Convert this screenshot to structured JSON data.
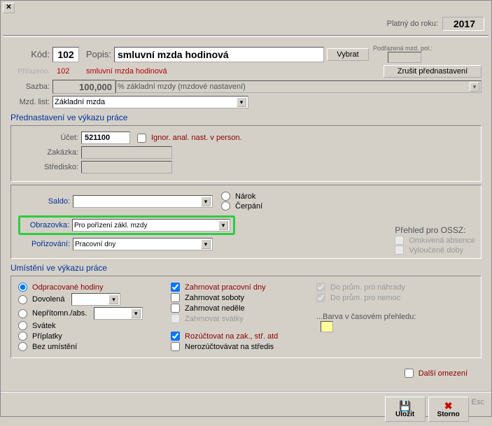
{
  "header": {
    "validToLabel": "Platný do roku:",
    "year": "2017"
  },
  "mainRow": {
    "kodLabel": "Kód:",
    "kod": "102",
    "popisLabel": "Popis:",
    "popis": "smluvní mzda hodinová",
    "vybratBtn": "Vybrat",
    "podrazenaLabel": "Podřazená mzd. pol.:",
    "prirazeno": "Přiřazeno:",
    "prirazenoKod": "102",
    "prirazenoText": "smluvní mzda hodinová",
    "zrusitBtn": "Zrušit přednastavení"
  },
  "sazba": {
    "label": "Sazba:",
    "value": "100,000",
    "unit": "% základní mzdy (mzdové nastavení)"
  },
  "mzdList": {
    "label": "Mzd. list:",
    "value": "Základní mzda"
  },
  "prednastaveni": {
    "title": "Přednastavení ve výkazu práce",
    "ucetLabel": "Účet:",
    "ucet": "521100",
    "ignorLabel": "Ignor. anal. nast. v person.",
    "zakazkaLabel": "Zakázka:",
    "strediskoLabel": "Středisko:"
  },
  "saldo": {
    "label": "Saldo:",
    "narok": "Nárok",
    "cerpani": "Čerpání"
  },
  "obrazovka": {
    "label": "Obrazovka:",
    "value": "Pro pořízení zákl. mzdy"
  },
  "porizovani": {
    "label": "Pořizování:",
    "value": "Pracovní dny"
  },
  "ossz": {
    "title": "Přehled pro OSSZ:",
    "omluvena": "Omluvená absence",
    "vyloucene": "Vyloučené doby"
  },
  "umisteni": {
    "title": "Umístění ve výkazu práce",
    "odpracovane": "Odpracované hodiny",
    "dovolena": "Dovolená",
    "nepritomn": "Nepřítomn./abs.",
    "svatek": "Svátek",
    "priplatky": "Příplatky",
    "bezUmisteni": "Bez umístění"
  },
  "zahrnovat": {
    "pracovniDny": "Zahrnovat pracovní dny",
    "soboty": "Zahrnovat soboty",
    "nedele": "Zahrnovat neděle",
    "svatky": "Zahrnovat svátky",
    "rozuctovat": "Rozúčtovat na zak., stř. atd",
    "nerozuctovavat": "Nerozúčtovávat na středis"
  },
  "prum": {
    "nahrady": "Do prům. pro náhrady",
    "nemoc": "Do prům. pro nemoc"
  },
  "barva": {
    "label": "...Barva v časovém přehledu:"
  },
  "dalsiOmezeni": "Další omezení",
  "buttons": {
    "ulozit": "Uložit",
    "storno": "Storno",
    "esc": "Esc"
  }
}
